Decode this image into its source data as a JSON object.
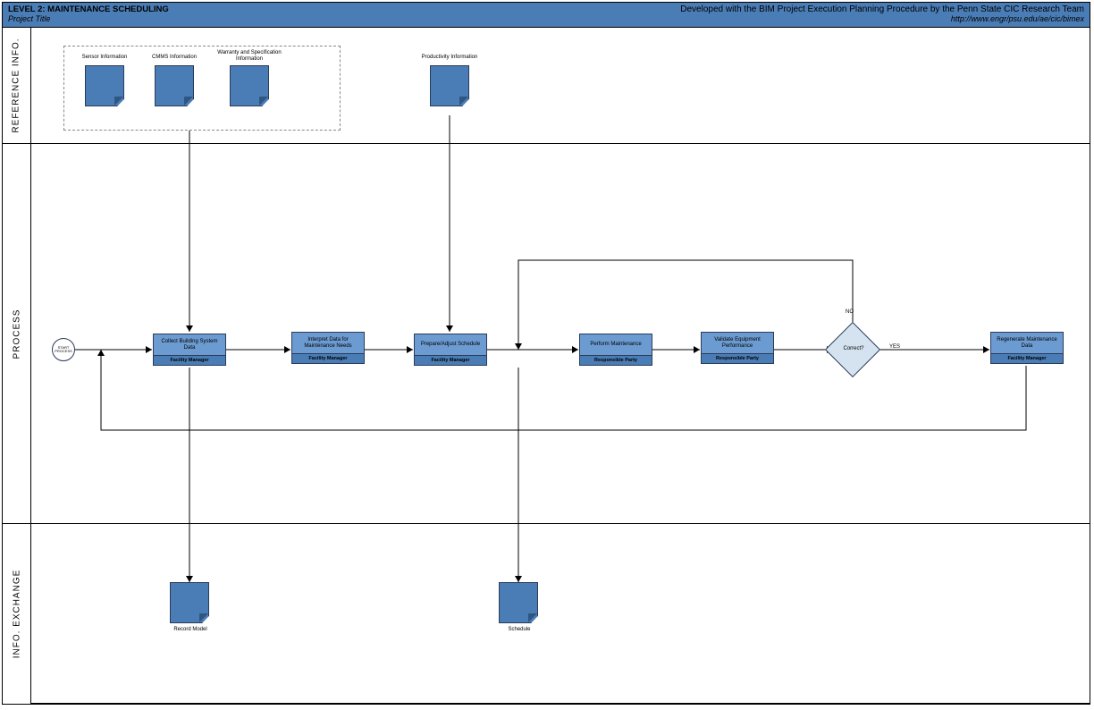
{
  "header": {
    "title": "LEVEL 2: MAINTENANCE SCHEDULING",
    "subtitle": "Project Title",
    "credit": "Developed with the BIM Project Execution Planning Procedure by the Penn State CIC Research Team",
    "url": "http://www.engr/psu.edu/ae/cic/bimex"
  },
  "lanes": {
    "reference": "REFERENCE INFO.",
    "process": "PROCESS",
    "info_exchange": "INFO. EXCHANGE"
  },
  "ref_docs": {
    "sensor": "Sensor Information",
    "cmms": "CMMS Information",
    "warranty": "Warranty and Specification Information",
    "productivity": "Productivity Information"
  },
  "start": "START PROCESS",
  "process_boxes": {
    "p1": {
      "task": "Collect Building System Data",
      "role": "Facility Manager"
    },
    "p2": {
      "task": "Interpret Data for Maintenance Needs",
      "role": "Facility Manager"
    },
    "p3": {
      "task": "Prepare/Adjust Schedule",
      "role": "Facility Manager"
    },
    "p4": {
      "task": "Perform Maintenance",
      "role": "Responsible Party"
    },
    "p5": {
      "task": "Validate Equipment Performance",
      "role": "Responsible Party"
    },
    "p6": {
      "task": "Regenerate Maintenance Data",
      "role": "Facility Manager"
    }
  },
  "decision": {
    "label": "Correct?",
    "yes": "YES",
    "no": "NO"
  },
  "exchanges": {
    "record_model": "Record Model",
    "schedule": "Schedule"
  }
}
